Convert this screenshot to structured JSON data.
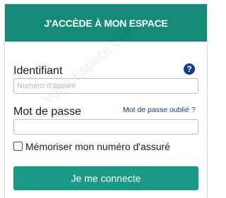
{
  "header": {
    "title": "J'ACCÈDE À MON ESPACE"
  },
  "watermark": "Votre Espace Client",
  "identifier": {
    "label": "Identifiant",
    "placeholder": "Numéro d'assuré",
    "help_icon": "help-icon",
    "help_glyph": "?"
  },
  "password": {
    "label": "Mot de passe",
    "forgot_link": "Mot de passe oublié ?"
  },
  "remember": {
    "label": "Mémoriser mon numéro d'assuré",
    "checked": false
  },
  "submit": {
    "label": "Je me connecte"
  },
  "colors": {
    "header": "#148a77",
    "button": "#1a9a86",
    "link": "#0f3d8c"
  }
}
